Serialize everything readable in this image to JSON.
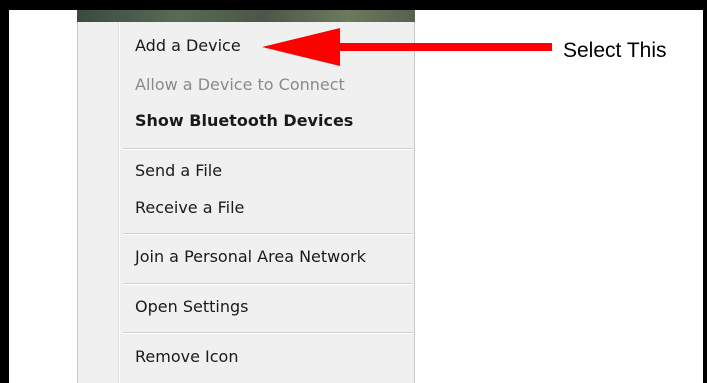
{
  "menu": {
    "items": [
      {
        "label": "Add a Device",
        "state": "enabled",
        "style": "normal"
      },
      {
        "label": "Allow a Device to Connect",
        "state": "disabled",
        "style": "normal"
      },
      {
        "label": "Show Bluetooth Devices",
        "state": "enabled",
        "style": "bold"
      },
      {
        "label": "Send a File",
        "state": "enabled",
        "style": "normal"
      },
      {
        "label": "Receive a File",
        "state": "enabled",
        "style": "normal"
      },
      {
        "label": "Join a Personal Area Network",
        "state": "enabled",
        "style": "normal"
      },
      {
        "label": "Open Settings",
        "state": "enabled",
        "style": "normal"
      },
      {
        "label": "Remove Icon",
        "state": "enabled",
        "style": "normal"
      }
    ]
  },
  "annotation": {
    "text": "Select This",
    "arrow_color": "#ff0000",
    "arrow_icon": "arrow-left-icon"
  },
  "colors": {
    "menu_background": "#f0f0f0",
    "frame": "#000000",
    "disabled_text": "#8a8a8a"
  }
}
